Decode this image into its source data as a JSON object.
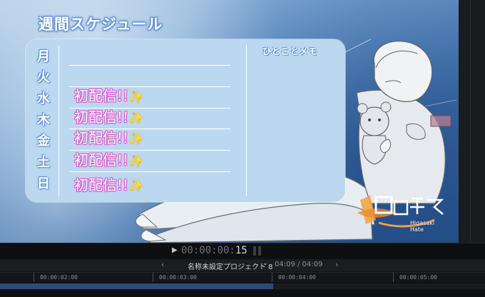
{
  "viewer": {
    "title": "週間スケジュール",
    "days": [
      "月",
      "火",
      "水",
      "木",
      "金",
      "土",
      "日"
    ],
    "entries": [
      {
        "text": "初配信!!",
        "emoji": "✨"
      },
      {
        "text": "初配信!!",
        "emoji": "✨"
      },
      {
        "text": "初配信!!",
        "emoji": "✨"
      },
      {
        "text": "初配信!!",
        "emoji": "✨"
      },
      {
        "text": "初配信!!",
        "emoji": "✨"
      }
    ],
    "memo_title": "ひとことメモ",
    "logo_subtext": "Higasaki Hate",
    "colors": {
      "panel": "#bcd8f0",
      "title_outline": "#5c8fd0",
      "entry_outline": "#d65bd0"
    }
  },
  "transport": {
    "timecode_dim": "00:00:00:",
    "timecode_frames": "15"
  },
  "timeline": {
    "project_name": "名称未設定プロジェクト 8",
    "duration": "04:09 / 04:09",
    "ruler_labels": [
      "00:00:02:00",
      "00:00:03:00",
      "00:00:04:00",
      "00:00:05:00"
    ],
    "clip_color": "#2e4a7a"
  }
}
